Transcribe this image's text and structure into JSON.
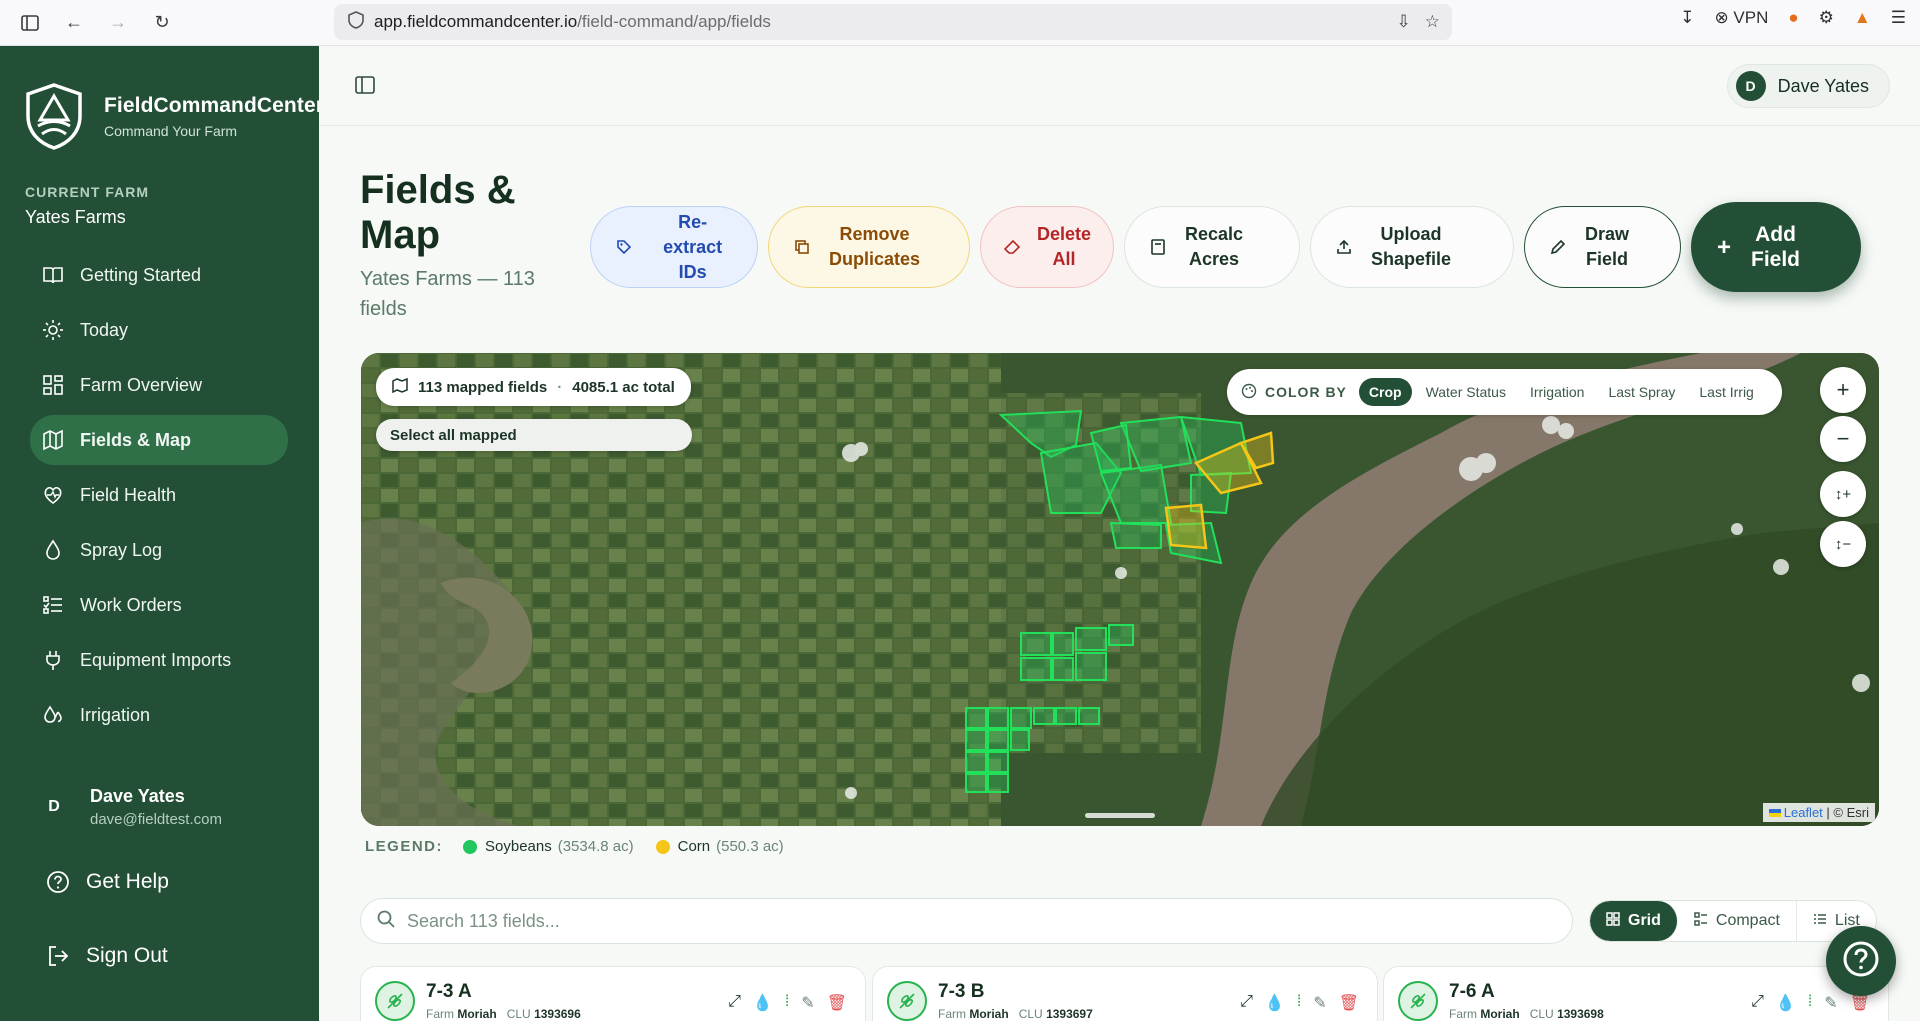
{
  "browser": {
    "url_host": "app.fieldcommandcenter.io",
    "url_path": "/field-command/app/fields",
    "vpn_label": "VPN"
  },
  "brand": {
    "name": "FieldCommandCenter",
    "tagline": "Command Your Farm"
  },
  "farm": {
    "label": "CURRENT FARM",
    "name": "Yates Farms"
  },
  "nav": {
    "items": [
      {
        "label": "Getting Started",
        "icon": "book-icon"
      },
      {
        "label": "Today",
        "icon": "sun-icon"
      },
      {
        "label": "Farm Overview",
        "icon": "grid-icon"
      },
      {
        "label": "Fields & Map",
        "icon": "map-icon",
        "active": true
      },
      {
        "label": "Field Health",
        "icon": "health-icon"
      },
      {
        "label": "Spray Log",
        "icon": "droplet-icon"
      },
      {
        "label": "Work Orders",
        "icon": "checklist-icon"
      },
      {
        "label": "Equipment Imports",
        "icon": "plug-icon"
      },
      {
        "label": "Irrigation",
        "icon": "drops-icon"
      }
    ]
  },
  "user": {
    "initial": "D",
    "name": "Dave Yates",
    "email": "dave@fieldtest.com"
  },
  "footer": {
    "help": "Get Help",
    "signout": "Sign Out"
  },
  "page": {
    "title": "Fields & Map",
    "subtitle": "Yates Farms — 113 fields"
  },
  "actions": {
    "reextract": [
      "Re-extract",
      "IDs"
    ],
    "remove_dupes": [
      "Remove",
      "Duplicates"
    ],
    "delete_all": [
      "Delete",
      "All"
    ],
    "recalc": [
      "Recalc",
      "Acres"
    ],
    "upload": [
      "Upload",
      "Shapefile"
    ],
    "draw": [
      "Draw",
      "Field"
    ],
    "add": [
      "Add",
      "Field"
    ]
  },
  "map": {
    "mapped_count": "113 mapped fields",
    "total_acres": "4085.1 ac total",
    "select_all": "Select all mapped",
    "color_by_label": "COLOR BY",
    "color_by_options": [
      "Crop",
      "Water Status",
      "Irrigation",
      "Last Spray",
      "Last Irrig"
    ],
    "color_by_selected": "Crop",
    "attribution_link": "Leaflet",
    "attribution_text": "| © Esri"
  },
  "legend": {
    "label": "LEGEND:",
    "items": [
      {
        "name": "Soybeans",
        "acres": "(3534.8 ac)",
        "color": "#22c55e"
      },
      {
        "name": "Corn",
        "acres": "(550.3 ac)",
        "color": "#f5c518"
      }
    ]
  },
  "search": {
    "placeholder": "Search 113 fields..."
  },
  "views": {
    "grid": "Grid",
    "compact": "Compact",
    "list": "List",
    "selected": "Grid"
  },
  "cards": [
    {
      "name": "7-3 A",
      "farm_label": "Farm",
      "farm": "Moriah",
      "clu_label": "CLU",
      "clu": "1393696"
    },
    {
      "name": "7-3 B",
      "farm_label": "Farm",
      "farm": "Moriah",
      "clu_label": "CLU",
      "clu": "1393697"
    },
    {
      "name": "7-6 A",
      "farm_label": "Farm",
      "farm": "Moriah",
      "clu_label": "CLU",
      "clu": "1393698"
    }
  ],
  "colors": {
    "sidebar": "#234f36",
    "accent": "#2f7049",
    "soy": "#22c55e",
    "corn": "#f5c518"
  }
}
